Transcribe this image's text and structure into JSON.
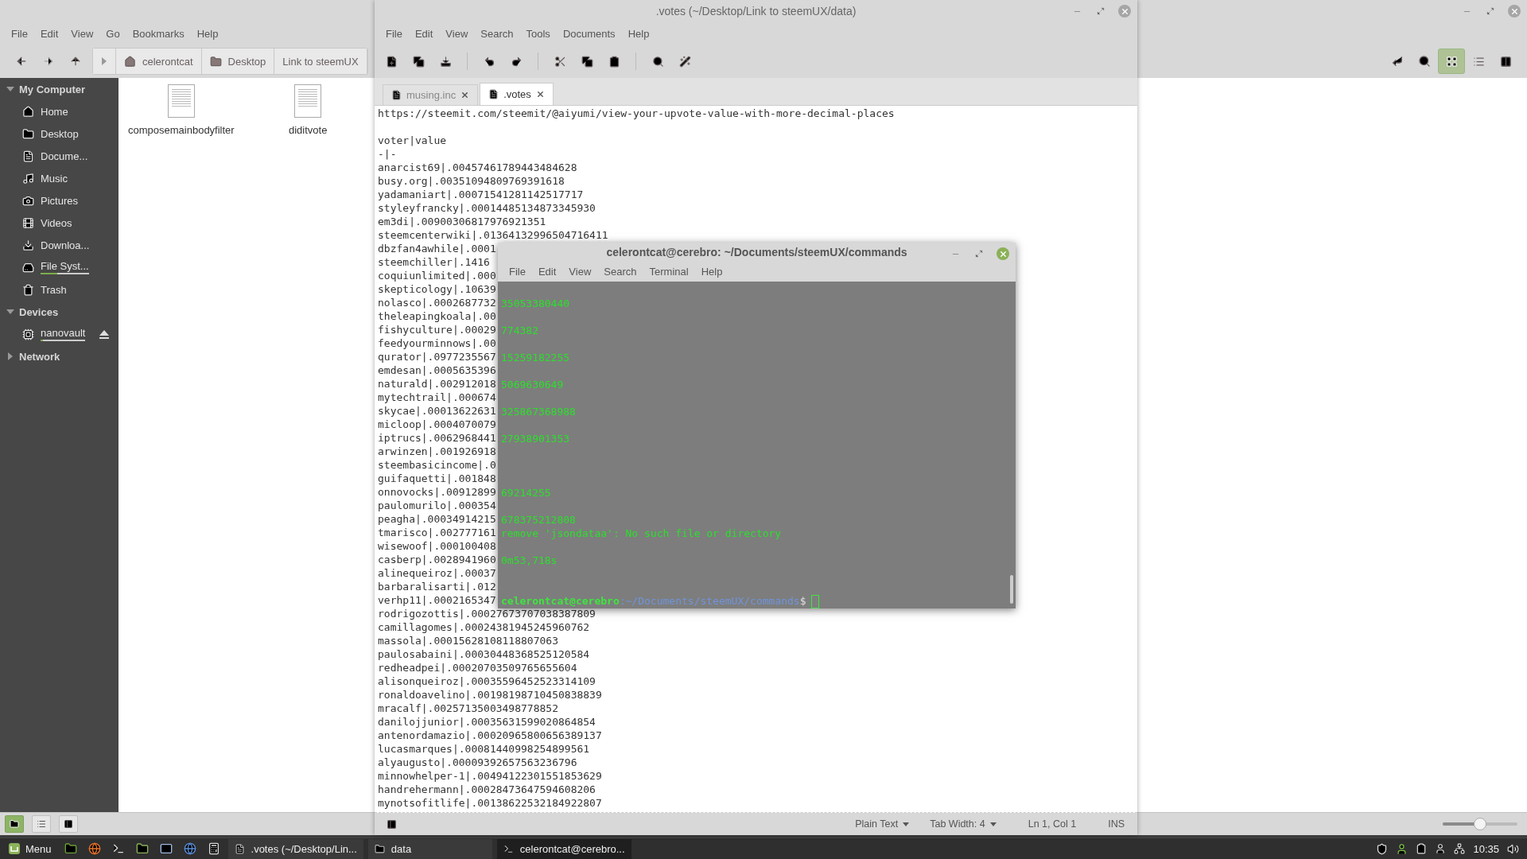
{
  "file_manager": {
    "menu": [
      "File",
      "Edit",
      "View",
      "Go",
      "Bookmarks",
      "Help"
    ],
    "path_buttons": [
      "celerontcat",
      "Desktop",
      "Link to steemUX"
    ],
    "view_modes": [
      {
        "selected": true
      },
      {
        "selected": false
      },
      {
        "selected": false
      }
    ],
    "sidebar": [
      {
        "heading": "My Computer",
        "expanded": true,
        "items": [
          {
            "label": "Home"
          },
          {
            "label": "Desktop"
          },
          {
            "label": "Docume..."
          },
          {
            "label": "Music"
          },
          {
            "label": "Pictures"
          },
          {
            "label": "Videos"
          },
          {
            "label": "Downloa..."
          },
          {
            "label": "File Syst...",
            "level": 0.35
          },
          {
            "label": "Trash"
          }
        ]
      },
      {
        "heading": "Devices",
        "expanded": true,
        "items": [
          {
            "label": "nanovault",
            "level": 0.05
          }
        ]
      },
      {
        "heading": "Network",
        "expanded": false
      }
    ],
    "files": [
      "composemainbodyfilter",
      "diditvote"
    ],
    "status_buttons": [
      {
        "selected": true
      },
      {
        "selected": false
      },
      {
        "selected": false
      }
    ],
    "zoom": {
      "level": 0.5
    }
  },
  "editor": {
    "title": ".votes (~/Desktop/Link to steemUX/data)",
    "menu": [
      "File",
      "Edit",
      "View",
      "Search",
      "Tools",
      "Documents",
      "Help"
    ],
    "tabs": [
      {
        "label": "musing.inc",
        "selected": false
      },
      {
        "label": ".votes",
        "selected": true
      }
    ],
    "first_line": "https://steemit.com/steemit/@aiyumi/view-your-upvote-value-with-more-decimal-places",
    "lines": [
      "voter|value",
      "-|-",
      "anarcist69|.00457461789443484628",
      "busy.org|.00351094809769391618",
      "yadamaniart|.00071541281142517717",
      "styleyfrancky|.00014485134873345930",
      "em3di|.00900306817976921351",
      "steemcenterwiki|.01364132996504716411",
      "dbzfan4awhile|.0001",
      "steemchiller|.1416",
      "coquiunlimited|.000",
      "skepticology|.10639",
      "nolasco|.0002687732",
      "theleapingkoala|.00",
      "fishyculture|.00029",
      "feedyourminnows|.00",
      "qurator|.0977235567",
      "emdesan|.0005635396",
      "naturald|.002912018",
      "mytechtrail|.000674",
      "skycae|.00013622631",
      "micloop|.0004070079",
      "iptrucs|.0062968441",
      "arwinzen|.001926918",
      "steembasicincome|.0",
      "guifaquetti|.001848",
      "onnovocks|.00912899",
      "paulomurilo|.000354",
      "peagha|.00034914215",
      "tmarisco|.002777161",
      "wisewoof|.000100408",
      "casberp|.0028941960",
      "alinequeiroz|.00037",
      "barbaralisarti|.012",
      "verhp11|.0002165347",
      "rodrigozottis|.00027673707038387809",
      "camillagomes|.00024381945245960762",
      "massola|.00015628108118807063",
      "paulosabaini|.00030448368525120584",
      "redheadpei|.00020703509765655604",
      "alisonqueiroz|.00035596452523314109",
      "ronaldoavelino|.00198198710450838839",
      "mracalf|.00257135003498778852",
      "danilojjunior|.00035631599020864854",
      "antenordamazio|.00020965800656389137",
      "lucasmarques|.00081440998254899561",
      "alyaugusto|.00009392657563236796",
      "minnowhelper-1|.00494122301551853629",
      "handrehermann|.00028473647594608206",
      "mynotsofitlife|.00138622532184922807"
    ],
    "status": {
      "language": "Plain Text",
      "tab_width": "Tab Width: 4",
      "position": "Ln 1, Col 1",
      "mode": "INS"
    }
  },
  "terminal": {
    "title": "celerontcat@cerebro: ~/Documents/steemUX/commands",
    "menu": [
      "File",
      "Edit",
      "View",
      "Search",
      "Terminal",
      "Help"
    ],
    "lines": [
      {
        "kind": "blank"
      },
      {
        "kind": "output",
        "text": "35053380440"
      },
      {
        "kind": "blank"
      },
      {
        "kind": "output",
        "text": "774382"
      },
      {
        "kind": "blank"
      },
      {
        "kind": "output",
        "text": "15259182255"
      },
      {
        "kind": "blank"
      },
      {
        "kind": "output",
        "text": "5069630649"
      },
      {
        "kind": "blank"
      },
      {
        "kind": "output",
        "text": "325867368988"
      },
      {
        "kind": "blank"
      },
      {
        "kind": "output",
        "text": "27938901353"
      },
      {
        "kind": "blank"
      },
      {
        "kind": "blank"
      },
      {
        "kind": "blank"
      },
      {
        "kind": "output",
        "text": "69214255"
      },
      {
        "kind": "blank"
      },
      {
        "kind": "output",
        "text": "678375212808"
      },
      {
        "kind": "output",
        "text": "remove 'jsondataa': No such file or directory"
      },
      {
        "kind": "blank"
      },
      {
        "kind": "output",
        "text": "0m53,718s"
      },
      {
        "kind": "blank"
      },
      {
        "kind": "blank"
      },
      {
        "kind": "prompt",
        "user": "celerontcat@cerebro",
        "path": ":~/Documents/steemUX/commands",
        "symbol": "$"
      }
    ]
  },
  "taskbar": {
    "menu_label": "Menu",
    "windows": [
      {
        "label": ".votes (~/Desktop/Lin...",
        "selected": false
      },
      {
        "label": "data",
        "selected": false
      },
      {
        "label": "celerontcat@cerebro...",
        "selected": true
      }
    ],
    "clock": "10:35"
  }
}
